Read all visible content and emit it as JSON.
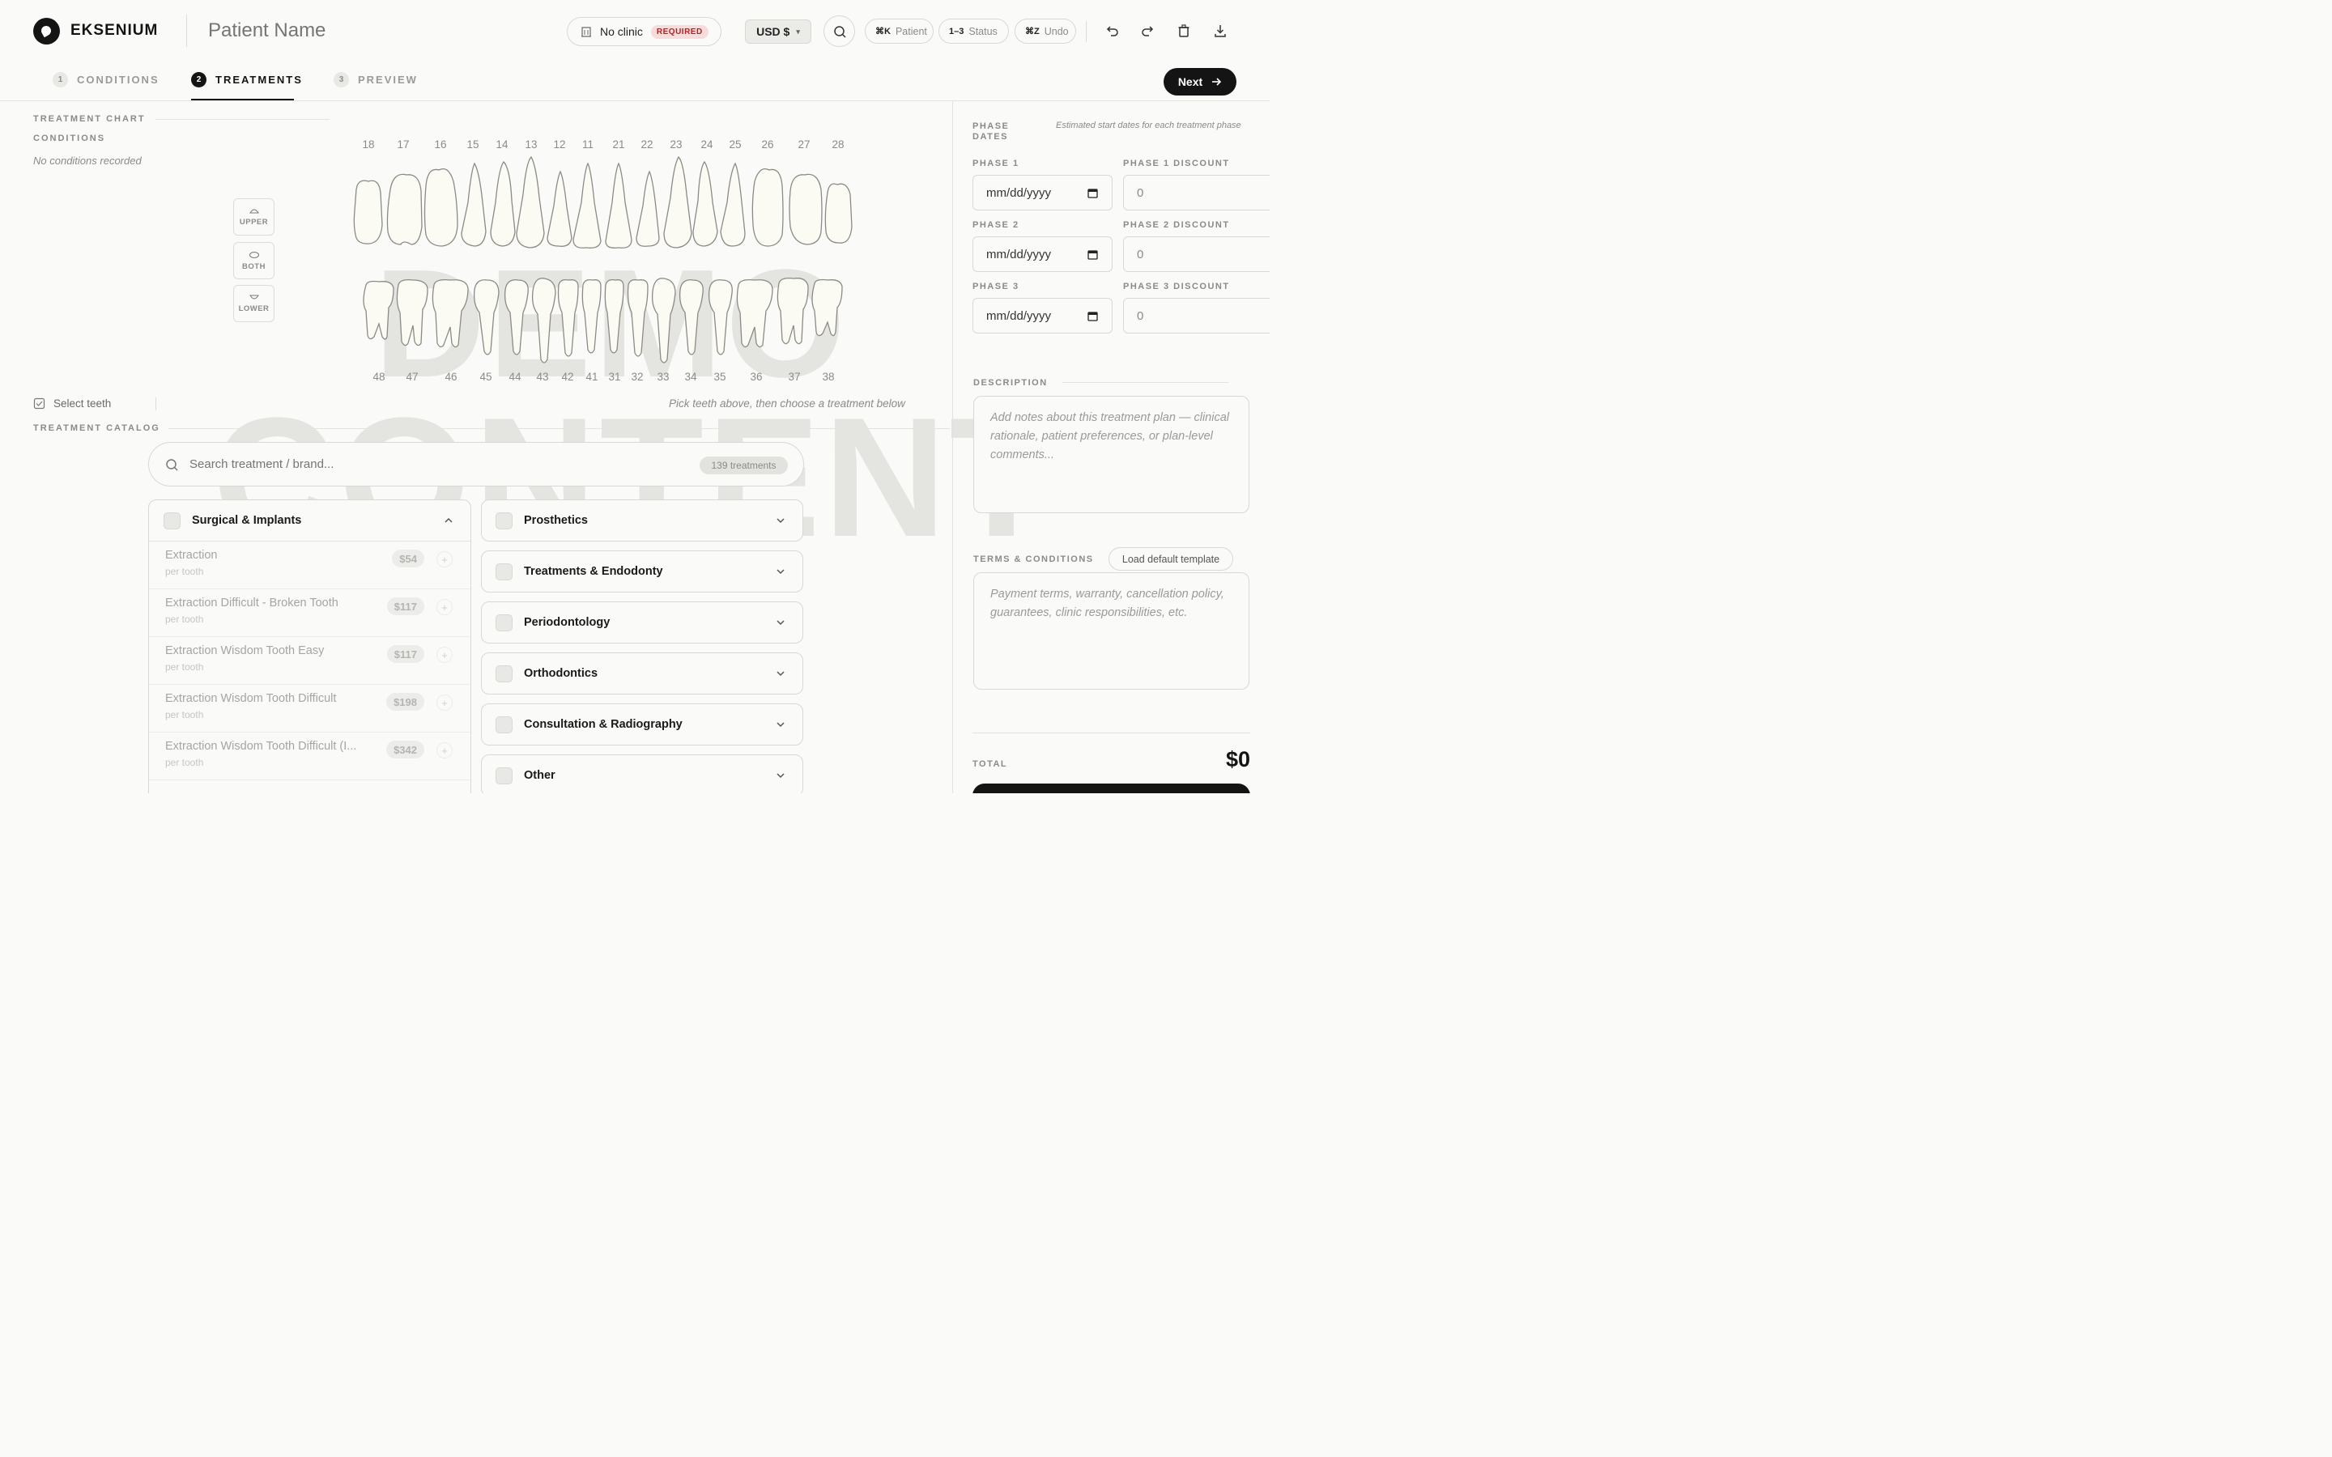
{
  "header": {
    "brand": "EKSENIUM",
    "patient_placeholder": "Patient Name",
    "clinic_label": "No clinic",
    "clinic_required": "REQUIRED",
    "currency": "USD $",
    "shortcuts": [
      {
        "key": "⌘K",
        "label": "Patient"
      },
      {
        "key": "1–3",
        "label": "Status"
      },
      {
        "key": "⌘Z",
        "label": "Undo"
      }
    ]
  },
  "tabs": [
    {
      "num": "1",
      "label": "CONDITIONS"
    },
    {
      "num": "2",
      "label": "TREATMENTS"
    },
    {
      "num": "3",
      "label": "PREVIEW"
    }
  ],
  "next_label": "Next",
  "chart": {
    "title": "TREATMENT CHART",
    "conditions_label": "CONDITIONS",
    "no_conditions": "No conditions recorded",
    "arch_buttons": [
      "UPPER",
      "BOTH",
      "LOWER"
    ],
    "upper_teeth": [
      "18",
      "17",
      "16",
      "15",
      "14",
      "13",
      "12",
      "11",
      "21",
      "22",
      "23",
      "24",
      "25",
      "26",
      "27",
      "28"
    ],
    "lower_teeth": [
      "48",
      "47",
      "46",
      "45",
      "44",
      "43",
      "42",
      "41",
      "31",
      "32",
      "33",
      "34",
      "35",
      "36",
      "37",
      "38"
    ],
    "select_teeth": "Select teeth",
    "hint": "Pick teeth above, then choose a treatment below"
  },
  "watermark": [
    "DEMO",
    "CONTENT"
  ],
  "catalog": {
    "title": "TREATMENT CATALOG",
    "search_placeholder": "Search treatment / brand...",
    "count": "139 treatments",
    "open_category": "Surgical & Implants",
    "items": [
      {
        "name": "Extraction",
        "unit": "per tooth",
        "price": "$54"
      },
      {
        "name": "Extraction Difficult - Broken Tooth",
        "unit": "per tooth",
        "price": "$117"
      },
      {
        "name": "Extraction Wisdom Tooth Easy",
        "unit": "per tooth",
        "price": "$117"
      },
      {
        "name": "Extraction Wisdom Tooth Difficult",
        "unit": "per tooth",
        "price": "$198"
      },
      {
        "name": "Extraction Wisdom Tooth Difficult (I...",
        "unit": "per tooth",
        "price": "$342"
      }
    ],
    "categories": [
      "Prosthetics",
      "Treatments & Endodonty",
      "Periodontology",
      "Orthodontics",
      "Consultation & Radiography",
      "Other"
    ]
  },
  "right": {
    "phase_dates_label": "PHASE DATES",
    "phase_note": "Estimated start dates for each treatment phase",
    "phases": [
      {
        "label": "PHASE 1",
        "discount_label": "PHASE 1 DISCOUNT",
        "date": "mm/dd/yyyy",
        "discount": "0"
      },
      {
        "label": "PHASE 2",
        "discount_label": "PHASE 2 DISCOUNT",
        "date": "mm/dd/yyyy",
        "discount": "0"
      },
      {
        "label": "PHASE 3",
        "discount_label": "PHASE 3 DISCOUNT",
        "date": "mm/dd/yyyy",
        "discount": "0"
      }
    ],
    "description_label": "DESCRIPTION",
    "description_placeholder": "Add notes about this treatment plan — clinical rationale, patient preferences, or plan-level comments...",
    "terms_label": "TERMS & CONDITIONS",
    "load_template": "Load default template",
    "terms_placeholder": "Payment terms, warranty, cancellation policy, guarantees, clinic responsibilities, etc.",
    "total_label": "TOTAL",
    "total_value": "$0"
  }
}
